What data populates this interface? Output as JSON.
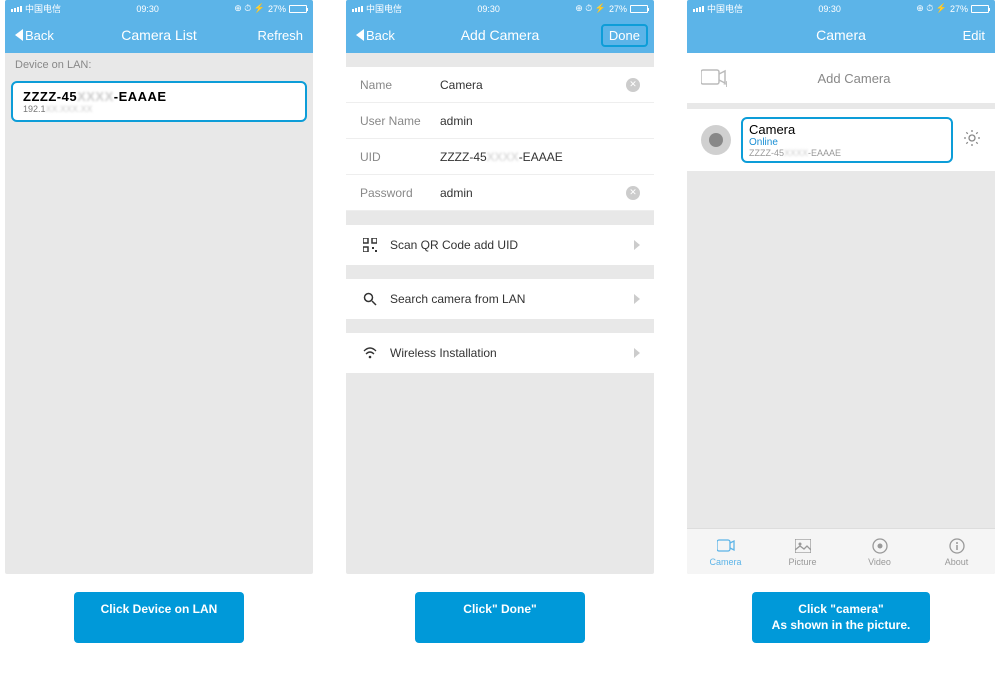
{
  "status_bar": {
    "carrier": "中国电信",
    "time": "09:30",
    "battery": "27%"
  },
  "screen1": {
    "nav": {
      "back": "Back",
      "title": "Camera List",
      "right": "Refresh"
    },
    "section_label": "Device on LAN:",
    "device": {
      "uid_prefix": "ZZZZ-45",
      "uid_suffix": "-EAAAE",
      "ip_prefix": "192.1"
    },
    "caption": "Click Device on LAN"
  },
  "screen2": {
    "nav": {
      "back": "Back",
      "title": "Add Camera",
      "right": "Done"
    },
    "fields": {
      "name": {
        "label": "Name",
        "value": "Camera"
      },
      "username": {
        "label": "User Name",
        "value": "admin"
      },
      "uid": {
        "label": "UID",
        "value_prefix": "ZZZZ-45",
        "value_suffix": "-EAAAE"
      },
      "password": {
        "label": "Password",
        "value": "admin"
      }
    },
    "actions": {
      "qr": "Scan QR Code add UID",
      "lan": "Search camera from LAN",
      "wifi": "Wireless Installation"
    },
    "caption": "Click\" Done\""
  },
  "screen3": {
    "nav": {
      "title": "Camera",
      "right": "Edit"
    },
    "add_camera": "Add Camera",
    "camera": {
      "name": "Camera",
      "status": "Online",
      "uid_prefix": "ZZZZ-45",
      "uid_suffix": "-EAAAE"
    },
    "tabs": {
      "camera": "Camera",
      "picture": "Picture",
      "video": "Video",
      "about": "About"
    },
    "caption_line1": "Click \"camera\"",
    "caption_line2": "As shown in the picture."
  }
}
